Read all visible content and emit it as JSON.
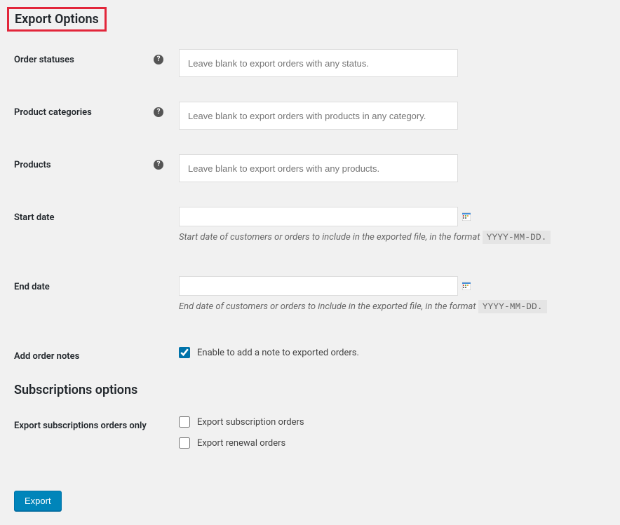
{
  "section_title": "Export Options",
  "fields": {
    "order_statuses": {
      "label": "Order statuses",
      "placeholder": "Leave blank to export orders with any status."
    },
    "product_categories": {
      "label": "Product categories",
      "placeholder": "Leave blank to export orders with products in any category."
    },
    "products": {
      "label": "Products",
      "placeholder": "Leave blank to export orders with any products."
    },
    "start_date": {
      "label": "Start date",
      "desc_prefix": "Start date of customers or orders to include in the exported file, in the format ",
      "format": "YYYY-MM-DD."
    },
    "end_date": {
      "label": "End date",
      "desc_prefix": "End date of customers or orders to include in the exported file, in the format ",
      "format": "YYYY-MM-DD."
    },
    "add_order_notes": {
      "label": "Add order notes",
      "checkbox_label": "Enable to add a note to exported orders.",
      "checked": true
    }
  },
  "subscriptions": {
    "title": "Subscriptions options",
    "label": "Export subscriptions orders only",
    "options": {
      "subscription_orders": {
        "label": "Export subscription orders",
        "checked": false
      },
      "renewal_orders": {
        "label": "Export renewal orders",
        "checked": false
      }
    }
  },
  "button": {
    "export": "Export"
  }
}
